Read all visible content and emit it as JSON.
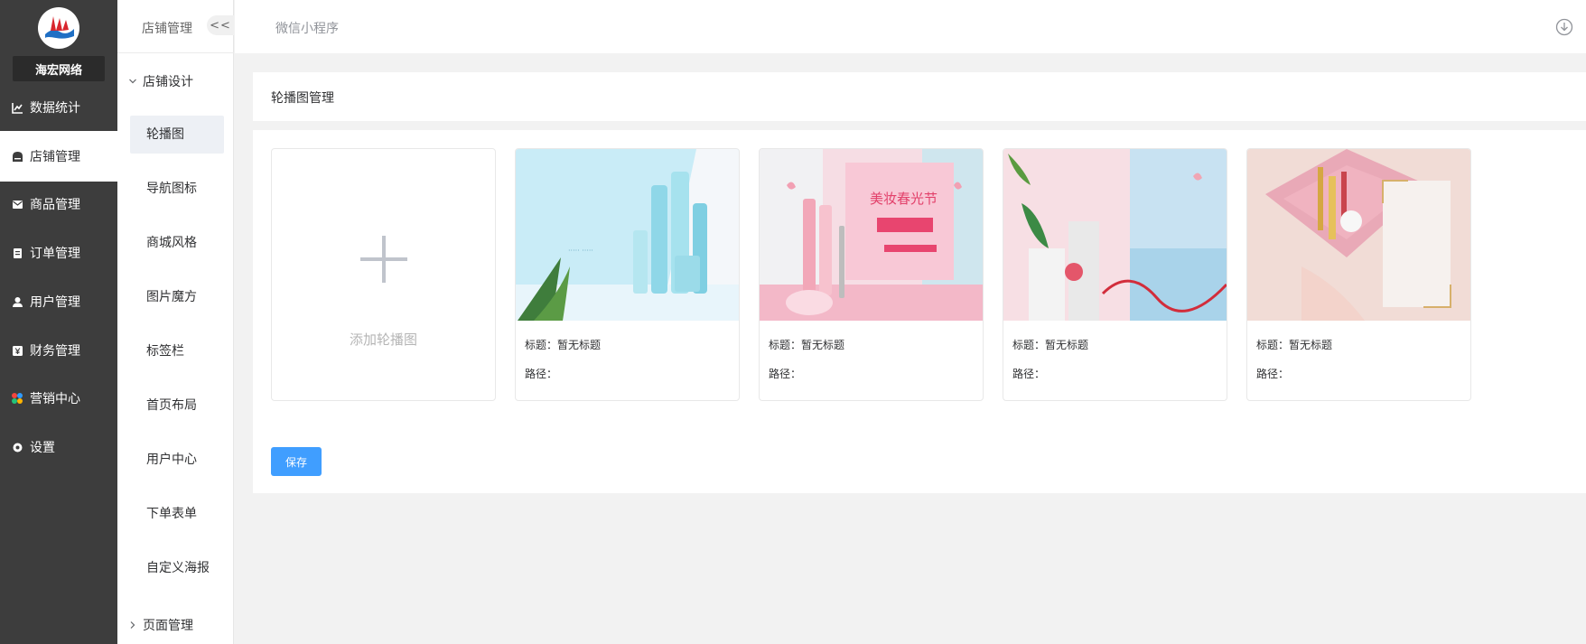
{
  "brand": {
    "name": "海宏网络"
  },
  "sidebar": {
    "items": [
      {
        "label": "数据统计",
        "icon": "chart-line-icon"
      },
      {
        "label": "店铺管理",
        "icon": "store-icon",
        "active": true
      },
      {
        "label": "商品管理",
        "icon": "envelope-icon"
      },
      {
        "label": "订单管理",
        "icon": "clipboard-icon"
      },
      {
        "label": "用户管理",
        "icon": "user-icon"
      },
      {
        "label": "财务管理",
        "icon": "yen-icon"
      },
      {
        "label": "营销中心",
        "icon": "marketing-icon"
      },
      {
        "label": "设置",
        "icon": "gear-icon"
      }
    ]
  },
  "submenu": {
    "header": "店铺管理",
    "collapse_label": "<<",
    "group1": "店铺设计",
    "items": [
      "轮播图",
      "导航图标",
      "商城风格",
      "图片魔方",
      "标签栏",
      "首页布局",
      "用户中心",
      "下单表单",
      "自定义海报"
    ],
    "group2": "页面管理"
  },
  "topbar": {
    "tab": "微信小程序"
  },
  "panel": {
    "title": "轮播图管理"
  },
  "add_card": {
    "label": "添加轮播图"
  },
  "cards": [
    {
      "title_label": "标题：暂无标题",
      "path_label": "路径："
    },
    {
      "title_label": "标题：暂无标题",
      "path_label": "路径：",
      "banner_title": "美妆春光节"
    },
    {
      "title_label": "标题：暂无标题",
      "path_label": "路径："
    },
    {
      "title_label": "标题：暂无标题",
      "path_label": "路径："
    }
  ],
  "save_label": "保存",
  "colors": {
    "sidebar_bg": "#3d3d3d",
    "primary": "#409eff",
    "page_bg": "#f2f2f2"
  }
}
